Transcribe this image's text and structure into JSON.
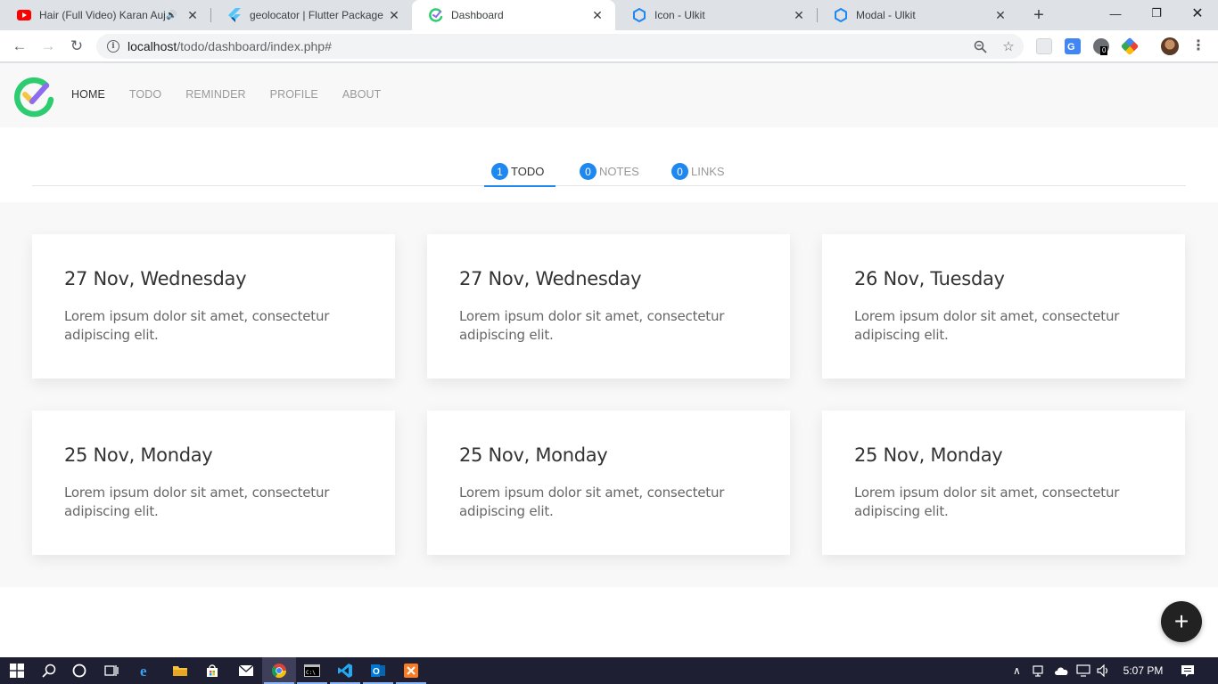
{
  "browser": {
    "tabs": [
      {
        "title": "Hair (Full Video) Karan Auj",
        "favicon": "youtube-icon",
        "active": false,
        "audio": true
      },
      {
        "title": "geolocator | Flutter Package",
        "favicon": "flutter-icon",
        "active": false
      },
      {
        "title": "Dashboard",
        "favicon": "todo-check-icon",
        "active": true
      },
      {
        "title": "Icon - Ulkit",
        "favicon": "uikit-icon",
        "active": false
      },
      {
        "title": "Modal - Ulkit",
        "favicon": "uikit-icon",
        "active": false
      }
    ],
    "url_host": "localhost",
    "url_path": "/todo/dashboard/index.php#",
    "extension_badge": "0"
  },
  "site": {
    "nav": [
      {
        "label": "Home",
        "active": true
      },
      {
        "label": "Todo",
        "active": false
      },
      {
        "label": "Reminder",
        "active": false
      },
      {
        "label": "Profile",
        "active": false
      },
      {
        "label": "About",
        "active": false
      }
    ],
    "tabs": [
      {
        "count": "1",
        "label": "Todo",
        "active": true
      },
      {
        "count": "0",
        "label": "Notes",
        "active": false
      },
      {
        "count": "0",
        "label": "Links",
        "active": false
      }
    ],
    "cards": [
      {
        "title": "27 Nov, Wednesday",
        "body": "Lorem ipsum dolor sit amet, consectetur adipiscing elit."
      },
      {
        "title": "27 Nov, Wednesday",
        "body": "Lorem ipsum dolor sit amet, consectetur adipiscing elit."
      },
      {
        "title": "26 Nov, Tuesday",
        "body": "Lorem ipsum dolor sit amet, consectetur adipiscing elit."
      },
      {
        "title": "25 Nov, Monday",
        "body": "Lorem ipsum dolor sit amet, consectetur adipiscing elit."
      },
      {
        "title": "25 Nov, Monday",
        "body": "Lorem ipsum dolor sit amet, consectetur adipiscing elit."
      },
      {
        "title": "25 Nov, Monday",
        "body": "Lorem ipsum dolor sit amet, consectetur adipiscing elit."
      }
    ],
    "fab_label": "+",
    "accent_color": "#1e87f0"
  },
  "taskbar": {
    "clock": "5:07 PM"
  }
}
